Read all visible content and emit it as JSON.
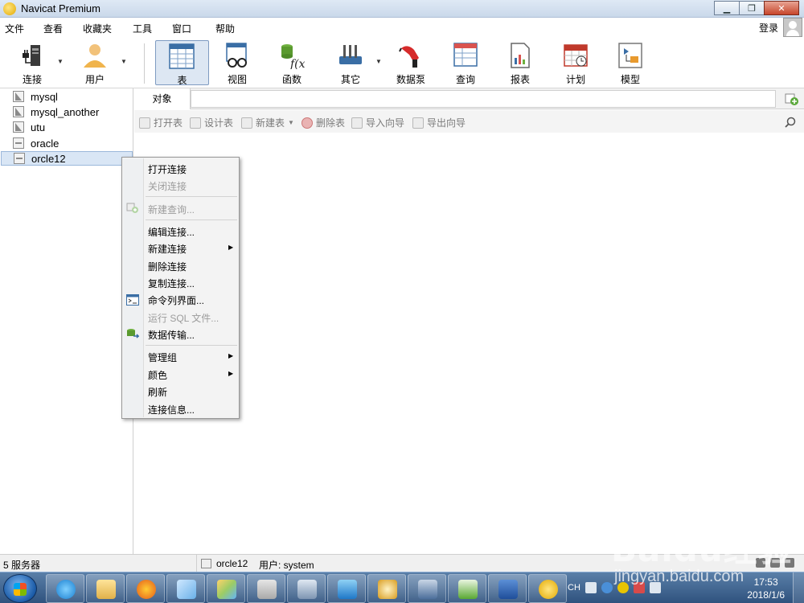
{
  "window": {
    "title": "Navicat Premium",
    "minimize": "▁",
    "maximize": "❐",
    "close": "✕"
  },
  "menubar": {
    "items": [
      "文件",
      "查看",
      "收藏夹",
      "工具",
      "窗口",
      "帮助"
    ],
    "login": "登录"
  },
  "toolbar": {
    "items": [
      {
        "label": "连接",
        "icon": "connection-icon"
      },
      {
        "label": "用户",
        "icon": "user-icon"
      },
      {
        "label": "表",
        "icon": "table-icon",
        "active": true
      },
      {
        "label": "视图",
        "icon": "view-icon"
      },
      {
        "label": "函数",
        "icon": "function-icon"
      },
      {
        "label": "其它",
        "icon": "other-icon"
      },
      {
        "label": "数据泵",
        "icon": "data-pump-icon"
      },
      {
        "label": "查询",
        "icon": "query-icon"
      },
      {
        "label": "报表",
        "icon": "report-icon"
      },
      {
        "label": "计划",
        "icon": "schedule-icon"
      },
      {
        "label": "模型",
        "icon": "model-icon"
      }
    ]
  },
  "nav": {
    "connections": [
      {
        "name": "mysql",
        "type": "mysql"
      },
      {
        "name": "mysql_another",
        "type": "mysql"
      },
      {
        "name": "utu",
        "type": "mysql"
      },
      {
        "name": "oracle",
        "type": "oracle"
      },
      {
        "name": "orcle12",
        "type": "oracle",
        "selected": true
      }
    ]
  },
  "main": {
    "tab": "对象",
    "object_toolbar": [
      "打开表",
      "设计表",
      "新建表",
      "删除表",
      "导入向导",
      "导出向导"
    ]
  },
  "context_menu": {
    "items": [
      {
        "label": "打开连接",
        "enabled": true
      },
      {
        "label": "关闭连接",
        "enabled": false
      },
      {
        "label": "新建查询...",
        "enabled": false
      },
      {
        "label": "编辑连接...",
        "enabled": true
      },
      {
        "label": "新建连接",
        "enabled": true,
        "submenu": true
      },
      {
        "label": "删除连接",
        "enabled": true
      },
      {
        "label": "复制连接...",
        "enabled": true
      },
      {
        "label": "命令列界面...",
        "enabled": true
      },
      {
        "label": "运行 SQL 文件...",
        "enabled": false
      },
      {
        "label": "数据传输...",
        "enabled": true
      },
      {
        "label": "管理组",
        "enabled": true,
        "submenu": true
      },
      {
        "label": "颜色",
        "enabled": true,
        "submenu": true
      },
      {
        "label": "刷新",
        "enabled": true
      },
      {
        "label": "连接信息...",
        "enabled": true
      }
    ]
  },
  "statusbar": {
    "server_count": "5 服务器",
    "connection": "orcle12",
    "user": "用户: system"
  },
  "taskbar": {
    "tray_lang": "CH",
    "time": "17:53",
    "date": "2018/1/6"
  },
  "watermark": {
    "logo": "Baidu经验",
    "url": "jingyan.baidu.com"
  }
}
